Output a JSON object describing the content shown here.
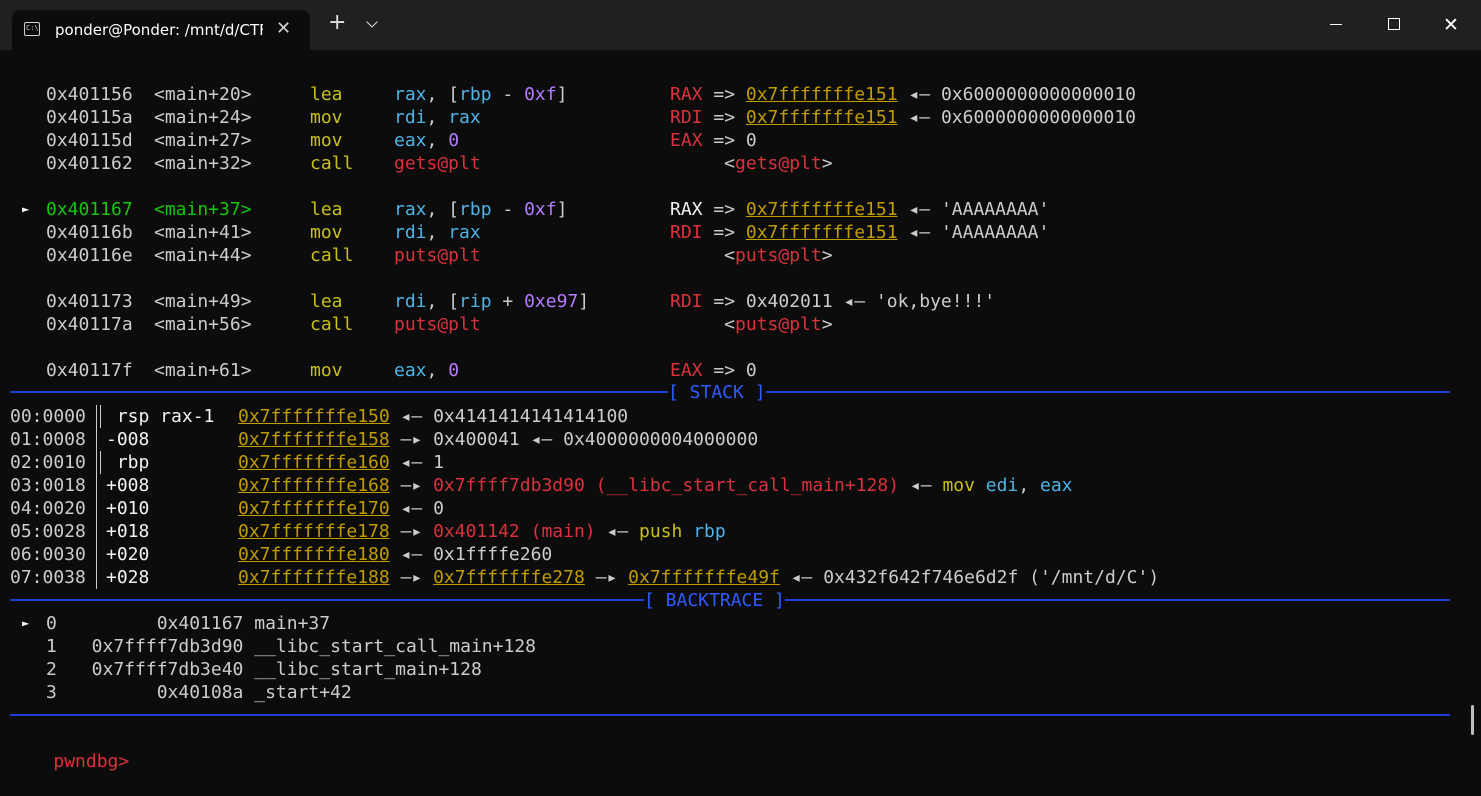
{
  "window": {
    "tab_title": "ponder@Ponder: /mnt/d/CTF:",
    "tab_icon": "terminal-icon",
    "new_tab": "+",
    "close_glyph": "✕"
  },
  "disasm": [
    {
      "addr": "0x401156",
      "sym": "<main+20>",
      "mn": "lea",
      "ops": [
        [
          "rax",
          "cy"
        ],
        [
          ", [",
          "w"
        ],
        [
          "rbp",
          "cy"
        ],
        [
          " - ",
          "w"
        ],
        [
          "0xf",
          "p"
        ],
        [
          "]",
          "w"
        ]
      ],
      "cm": [
        [
          "RAX",
          "r"
        ],
        [
          " => ",
          "w"
        ],
        [
          "0x7fffffffe151",
          "u"
        ],
        [
          " ◂— 0x6000000000000010",
          "w"
        ]
      ]
    },
    {
      "addr": "0x40115a",
      "sym": "<main+24>",
      "mn": "mov",
      "ops": [
        [
          "rdi",
          "cy"
        ],
        [
          ", ",
          "w"
        ],
        [
          "rax",
          "cy"
        ]
      ],
      "cm": [
        [
          "RDI",
          "r"
        ],
        [
          " => ",
          "w"
        ],
        [
          "0x7fffffffe151",
          "u"
        ],
        [
          " ◂— 0x6000000000000010",
          "w"
        ]
      ]
    },
    {
      "addr": "0x40115d",
      "sym": "<main+27>",
      "mn": "mov",
      "ops": [
        [
          "eax",
          "cy"
        ],
        [
          ", ",
          "w"
        ],
        [
          "0",
          "p"
        ]
      ],
      "cm": [
        [
          "EAX",
          "r"
        ],
        [
          " => 0",
          "w"
        ]
      ]
    },
    {
      "addr": "0x401162",
      "sym": "<main+32>",
      "mn": "call",
      "ops": [
        [
          "gets@plt",
          "r"
        ]
      ],
      "cm": [
        [
          "     <",
          "w"
        ],
        [
          "gets@plt",
          "r"
        ],
        [
          ">",
          "w"
        ]
      ]
    },
    null,
    {
      "addr": "0x401167",
      "sym": "<main+37>",
      "mn": "lea",
      "cur": true,
      "ops": [
        [
          "rax",
          "cy"
        ],
        [
          ", [",
          "w"
        ],
        [
          "rbp",
          "cy"
        ],
        [
          " - ",
          "w"
        ],
        [
          "0xf",
          "p"
        ],
        [
          "]",
          "w"
        ]
      ],
      "cm": [
        [
          "RAX",
          "wb"
        ],
        [
          " => ",
          "w"
        ],
        [
          "0x7fffffffe151",
          "u"
        ],
        [
          " ◂— 'AAAAAAAA'",
          "w"
        ]
      ]
    },
    {
      "addr": "0x40116b",
      "sym": "<main+41>",
      "mn": "mov",
      "ops": [
        [
          "rdi",
          "cy"
        ],
        [
          ", ",
          "w"
        ],
        [
          "rax",
          "cy"
        ]
      ],
      "cm": [
        [
          "RDI",
          "r"
        ],
        [
          " => ",
          "w"
        ],
        [
          "0x7fffffffe151",
          "u"
        ],
        [
          " ◂— 'AAAAAAAA'",
          "w"
        ]
      ]
    },
    {
      "addr": "0x40116e",
      "sym": "<main+44>",
      "mn": "call",
      "ops": [
        [
          "puts@plt",
          "r"
        ]
      ],
      "cm": [
        [
          "     <",
          "w"
        ],
        [
          "puts@plt",
          "r"
        ],
        [
          ">",
          "w"
        ]
      ]
    },
    null,
    {
      "addr": "0x401173",
      "sym": "<main+49>",
      "mn": "lea",
      "ops": [
        [
          "rdi",
          "cy"
        ],
        [
          ", [",
          "w"
        ],
        [
          "rip",
          "cy"
        ],
        [
          " + ",
          "w"
        ],
        [
          "0xe97",
          "p"
        ],
        [
          "]",
          "w"
        ]
      ],
      "cm": [
        [
          "RDI",
          "r"
        ],
        [
          " => 0x402011 ◂— 'ok,bye!!!'",
          "w"
        ]
      ]
    },
    {
      "addr": "0x40117a",
      "sym": "<main+56>",
      "mn": "call",
      "ops": [
        [
          "puts@plt",
          "r"
        ]
      ],
      "cm": [
        [
          "     <",
          "w"
        ],
        [
          "puts@plt",
          "r"
        ],
        [
          ">",
          "w"
        ]
      ]
    },
    null,
    {
      "addr": "0x40117f",
      "sym": "<main+61>",
      "mn": "mov",
      "ops": [
        [
          "eax",
          "cy"
        ],
        [
          ", ",
          "w"
        ],
        [
          "0",
          "p"
        ]
      ],
      "cm": [
        [
          "EAX",
          "r"
        ],
        [
          " => 0",
          "w"
        ]
      ]
    }
  ],
  "cursor_marker": "►",
  "stack_label": "[ STACK ]",
  "stack": [
    {
      "idx": "00:0000",
      "off": " rsp rax-1 ",
      "segs": [
        [
          "0x7fffffffe150",
          "u"
        ],
        [
          " ◂— 0x4141414141414100",
          "w"
        ]
      ]
    },
    {
      "idx": "01:0008",
      "off": "-008       ",
      "segs": [
        [
          "0x7fffffffe158",
          "u"
        ],
        [
          " —▸ 0x400041 ◂— 0x4000000004000000",
          "w"
        ]
      ]
    },
    {
      "idx": "02:0010",
      "off": " rbp       ",
      "segs": [
        [
          "0x7fffffffe160",
          "u"
        ],
        [
          " ◂— 1",
          "w"
        ]
      ]
    },
    {
      "idx": "03:0018",
      "off": "+008       ",
      "segs": [
        [
          "0x7fffffffe168",
          "u"
        ],
        [
          " —▸ ",
          "w"
        ],
        [
          "0x7ffff7db3d90 (__libc_start_call_main+128)",
          "r"
        ],
        [
          " ◂— ",
          "w"
        ],
        [
          "mov ",
          "y"
        ],
        [
          "edi",
          "cy"
        ],
        [
          ", ",
          "w"
        ],
        [
          "eax",
          "cy"
        ]
      ]
    },
    {
      "idx": "04:0020",
      "off": "+010       ",
      "segs": [
        [
          "0x7fffffffe170",
          "u"
        ],
        [
          " ◂— 0",
          "w"
        ]
      ]
    },
    {
      "idx": "05:0028",
      "off": "+018       ",
      "segs": [
        [
          "0x7fffffffe178",
          "u"
        ],
        [
          " —▸ ",
          "w"
        ],
        [
          "0x401142 (main)",
          "r"
        ],
        [
          " ◂— ",
          "w"
        ],
        [
          "push ",
          "y"
        ],
        [
          "rbp",
          "cy"
        ]
      ]
    },
    {
      "idx": "06:0030",
      "off": "+020       ",
      "segs": [
        [
          "0x7fffffffe180",
          "u"
        ],
        [
          " ◂— 0x1ffffe260",
          "w"
        ]
      ]
    },
    {
      "idx": "07:0038",
      "off": "+028       ",
      "segs": [
        [
          "0x7fffffffe188",
          "u"
        ],
        [
          " —▸ ",
          "w"
        ],
        [
          "0x7fffffffe278",
          "u"
        ],
        [
          " —▸ ",
          "w"
        ],
        [
          "0x7fffffffe49f",
          "u"
        ],
        [
          " ◂— 0x432f642f746e6d2f ('/mnt/d/C')",
          "w"
        ]
      ]
    }
  ],
  "backtrace_label": "[ BACKTRACE ]",
  "backtrace": [
    {
      "marker": "►",
      "n": "0",
      "text": "        0x401167 main+37"
    },
    {
      "marker": " ",
      "n": "1",
      "text": "  0x7ffff7db3d90 __libc_start_call_main+128"
    },
    {
      "marker": " ",
      "n": "2",
      "text": "  0x7ffff7db3e40 __libc_start_main+128"
    },
    {
      "marker": " ",
      "n": "3",
      "text": "        0x40108a _start+42"
    }
  ],
  "prompt": "pwndbg>",
  "colors": {
    "separator": "#1f3fd9",
    "highlight": "#16c60c",
    "register": "#d9323d",
    "address": "#c19c00"
  }
}
